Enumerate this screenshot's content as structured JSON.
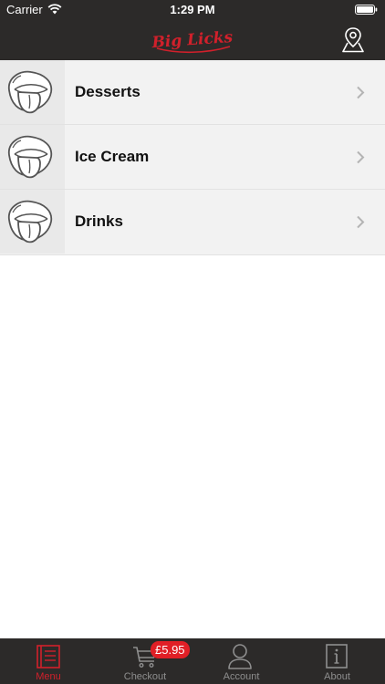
{
  "status_bar": {
    "carrier": "Carrier",
    "time": "1:29 PM"
  },
  "header": {
    "brand": "Big Licks",
    "brand_color": "#d1202b",
    "location_icon": "map-pin-icon"
  },
  "menu": {
    "items": [
      {
        "label": "Desserts",
        "icon": "lips-tongue-icon"
      },
      {
        "label": "Ice Cream",
        "icon": "lips-tongue-icon"
      },
      {
        "label": "Drinks",
        "icon": "lips-tongue-icon"
      }
    ]
  },
  "tab_bar": {
    "active_color": "#d1202b",
    "inactive_color": "#8e8e8e",
    "tabs": [
      {
        "label": "Menu",
        "icon": "menu-book-icon",
        "active": true
      },
      {
        "label": "Checkout",
        "icon": "cart-icon",
        "badge": "£5.95"
      },
      {
        "label": "Account",
        "icon": "user-icon"
      },
      {
        "label": "About",
        "icon": "info-icon"
      }
    ]
  }
}
